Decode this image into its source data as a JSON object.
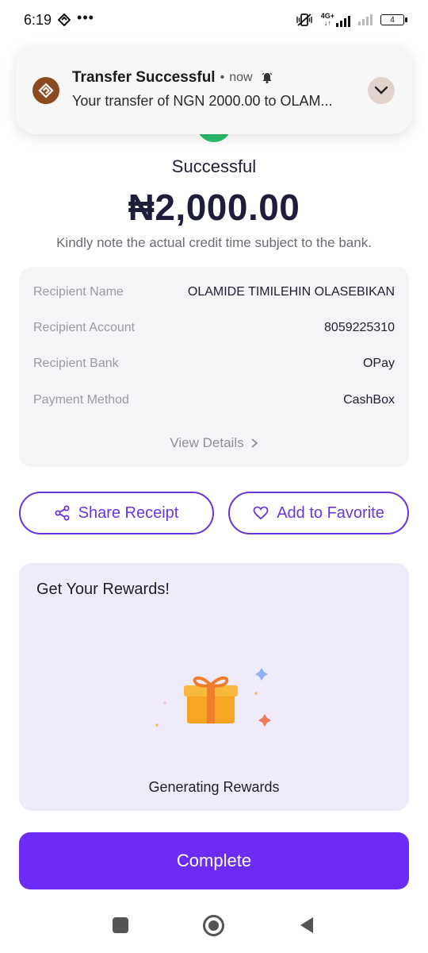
{
  "status_bar": {
    "time": "6:19",
    "overflow": "•••",
    "network_top": "4G+",
    "network_bottom": "↓↑",
    "battery": "4"
  },
  "notification": {
    "title": "Transfer Successful",
    "separator": "•",
    "time": "now",
    "body": "Your transfer of NGN 2000.00 to OLAM...",
    "app_icon": "opay-logo-icon",
    "expand_icon": "chevron-down-icon"
  },
  "transaction": {
    "status": "Successful",
    "amount": "₦2,000.00",
    "note": "Kindly note the actual credit time subject to the bank."
  },
  "details": {
    "rows": [
      {
        "label": "Recipient Name",
        "value": "OLAMIDE TIMILEHIN OLASEBIKAN"
      },
      {
        "label": "Recipient Account",
        "value": "8059225310"
      },
      {
        "label": "Recipient Bank",
        "value": "OPay"
      },
      {
        "label": "Payment Method",
        "value": "CashBox"
      }
    ],
    "view_details": "View Details"
  },
  "actions": {
    "share": "Share Receipt",
    "favorite": "Add to Favorite"
  },
  "rewards": {
    "title": "Get Your Rewards!",
    "status": "Generating Rewards"
  },
  "complete_label": "Complete",
  "colors": {
    "brand_purple": "#6c2cf5",
    "success_green": "#2bbf6b",
    "rewards_bg": "#efebfb",
    "card_bg": "#f5f5f8"
  }
}
